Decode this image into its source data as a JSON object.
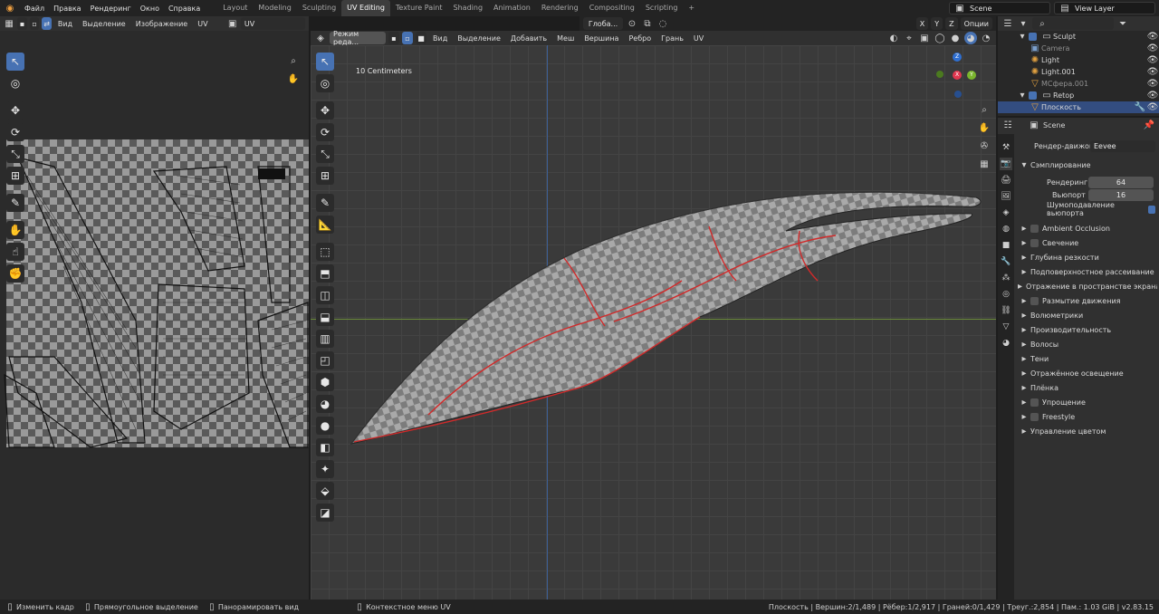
{
  "topbar": {
    "menu": [
      "Файл",
      "Правка",
      "Рендеринг",
      "Окно",
      "Справка"
    ],
    "workspaces": [
      "Layout",
      "Modeling",
      "Sculpting",
      "UV Editing",
      "Texture Paint",
      "Shading",
      "Animation",
      "Rendering",
      "Compositing",
      "Scripting"
    ],
    "active_workspace": "UV Editing",
    "scene": "Scene",
    "view_layer": "View Layer"
  },
  "uv_header": {
    "menu": [
      "Вид",
      "Выделение",
      "Изображение",
      "UV"
    ],
    "uv_map": "UV"
  },
  "vp_header": {
    "mode": "Режим реда...",
    "menu": [
      "Вид",
      "Выделение",
      "Добавить",
      "Меш",
      "Вершина",
      "Ребро",
      "Грань",
      "UV"
    ],
    "transform": "Глоба...",
    "axes": [
      "X",
      "Y",
      "Z"
    ],
    "options": "Опции"
  },
  "viewport": {
    "scale_label": "10 Centimeters",
    "gizmo": {
      "x": "X",
      "y": "Y",
      "z": "Z"
    }
  },
  "outliner": {
    "search_placeholder": "",
    "items": [
      {
        "label": "Sculpt",
        "indent": 1
      },
      {
        "label": "Camera",
        "indent": 2
      },
      {
        "label": "Light",
        "indent": 2
      },
      {
        "label": "Light.001",
        "indent": 2
      },
      {
        "label": "МСфера.001",
        "indent": 2
      },
      {
        "label": "Retop",
        "indent": 1
      },
      {
        "label": "Плоскость",
        "indent": 2,
        "selected": true
      }
    ]
  },
  "properties": {
    "context": "Scene",
    "render_engine_label": "Рендер-движок",
    "render_engine": "Eevee",
    "sampling": {
      "title": "Сэмплирование",
      "render_label": "Рендеринг",
      "render_value": "64",
      "viewport_label": "Вьюпорт",
      "viewport_value": "16",
      "denoise_label": "Шумоподавление вьюпорта"
    },
    "panels": [
      {
        "label": "Ambient Occlusion",
        "checkbox": true
      },
      {
        "label": "Свечение",
        "checkbox": true
      },
      {
        "label": "Глубина резкости",
        "checkbox": false
      },
      {
        "label": "Подповерхностное рассеивание",
        "checkbox": false
      },
      {
        "label": "Отражение в пространстве экрана",
        "checkbox": true
      },
      {
        "label": "Размытие движения",
        "checkbox": true
      },
      {
        "label": "Волюметрики",
        "checkbox": false
      },
      {
        "label": "Производительность",
        "checkbox": false
      },
      {
        "label": "Волосы",
        "checkbox": false
      },
      {
        "label": "Тени",
        "checkbox": false
      },
      {
        "label": "Отражённое освещение",
        "checkbox": false
      },
      {
        "label": "Плёнка",
        "checkbox": false
      },
      {
        "label": "Упрощение",
        "checkbox": true
      },
      {
        "label": "Freestyle",
        "checkbox": true
      },
      {
        "label": "Управление цветом",
        "checkbox": false
      }
    ]
  },
  "status": {
    "left": [
      "Изменить кадр",
      "Прямоугольное выделение",
      "Панорамировать вид",
      "Контекстное меню UV"
    ],
    "right": "Плоскость | Вершин:2/1,489 | Рёбер:1/2,917 | Граней:0/1,429 | Треуг.:2,854 | Пам.: 1.03 GiB | v2.83.15"
  },
  "colors": {
    "accent": "#4772b3",
    "selection": "#334d80",
    "seam": "#d22a2a"
  }
}
